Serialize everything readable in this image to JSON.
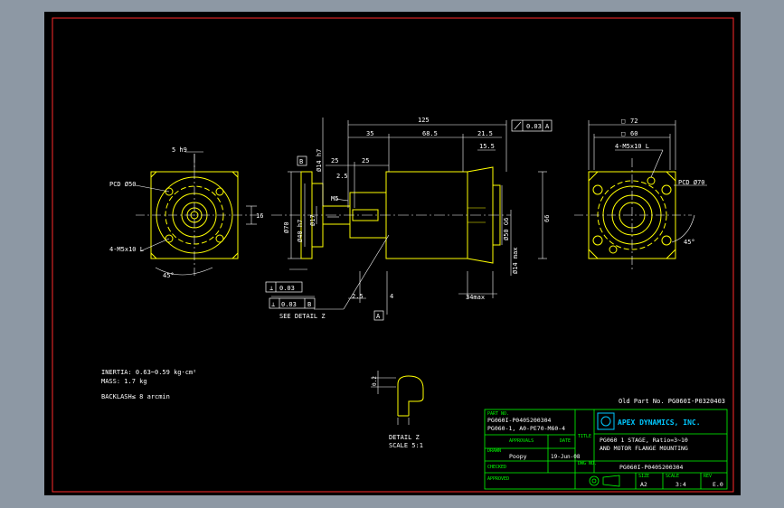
{
  "colors": {
    "background": "#8d98a4",
    "canvas": "#000000",
    "border": "#ff2a2a",
    "geometry": "#ffff00",
    "dimension": "#ffffff",
    "titleblock": "#00ff00",
    "logo": "#00c8ff",
    "red": "#ff3030"
  },
  "icons": {
    "logo": "apex-dynamics-logo-icon",
    "projection": "third-angle-projection-icon"
  },
  "front_view": {
    "pcd": "PCD Ø50",
    "holes": "4-M5x10  L",
    "angle": "45°",
    "key_width": "5 h9",
    "shaft_height": "16"
  },
  "side_view": {
    "total_length": "125",
    "flatness_frame": [
      "0.03",
      "A"
    ],
    "d_35": "35",
    "d_68_5": "68.5",
    "d_21_5": "21.5",
    "d_15_5": "15.5",
    "d_25a": "25",
    "d_25b": "25",
    "d_2_5": "2.5",
    "datum_b": "B",
    "datum_a": "A",
    "shaft_dia": "Ø14 h7",
    "pilot_dia": "Ø70",
    "flange_dia": "Ø40 h7",
    "hub_dia": "Ø17",
    "thread": "M5",
    "motor_pilot": "Ø50 G6",
    "motor_shaft": "Ø14 max",
    "motor_len": "34max",
    "runout_frame": [
      "0.03",
      "B"
    ],
    "see_detail": "SEE DETAIL Z",
    "d_2_5b": "2.5",
    "d_4": "4",
    "perp_frame": [
      "0.03"
    ],
    "overall_height": "66"
  },
  "rear_view": {
    "square_outer": "72",
    "square_inner": "60",
    "holes": "4-M5x10  L",
    "pcd": "PCD Ø70",
    "angle": "45°"
  },
  "detail": {
    "dim": "0.2",
    "title": "DETAIL Z",
    "scale": "SCALE 5:1"
  },
  "notes": {
    "inertia": "INERTIA: 0.63~0.59 kg·cm²",
    "mass": "MASS: 1.7 kg",
    "backlash": "BACKLASH≤ 8 arcmin"
  },
  "old_part": "Old Part No. PG060I-P0320403",
  "title_block": {
    "part_no_label": "PART NO.",
    "part_no_1": "PG060I-P0405200304",
    "part_no_2": "PG060-1, A0-PE70-M60-4",
    "approval_label": "APPROVALS",
    "date_label": "DATE",
    "drawn_label": "DRAWN",
    "drawn_value": "Poopy",
    "drawn_date": "19-Jun-08",
    "checked_label": "CHECKED",
    "approved_label": "APPROVED",
    "company": "APEX DYNAMICS, INC.",
    "title_label": "TITLE",
    "title_1": "PG060 1 STAGE, Ratio=3~10",
    "title_2": "AND MOTOR FLANGE MOUNTING",
    "dwg_label": "DWG NO.",
    "dwg_value": "PG060I-P0405200304",
    "size_label": "SIZE",
    "size_value": "A2",
    "scale_label": "SCALE",
    "scale_value": "3:4",
    "rev_label": "REV",
    "rev_value": "E.0"
  }
}
